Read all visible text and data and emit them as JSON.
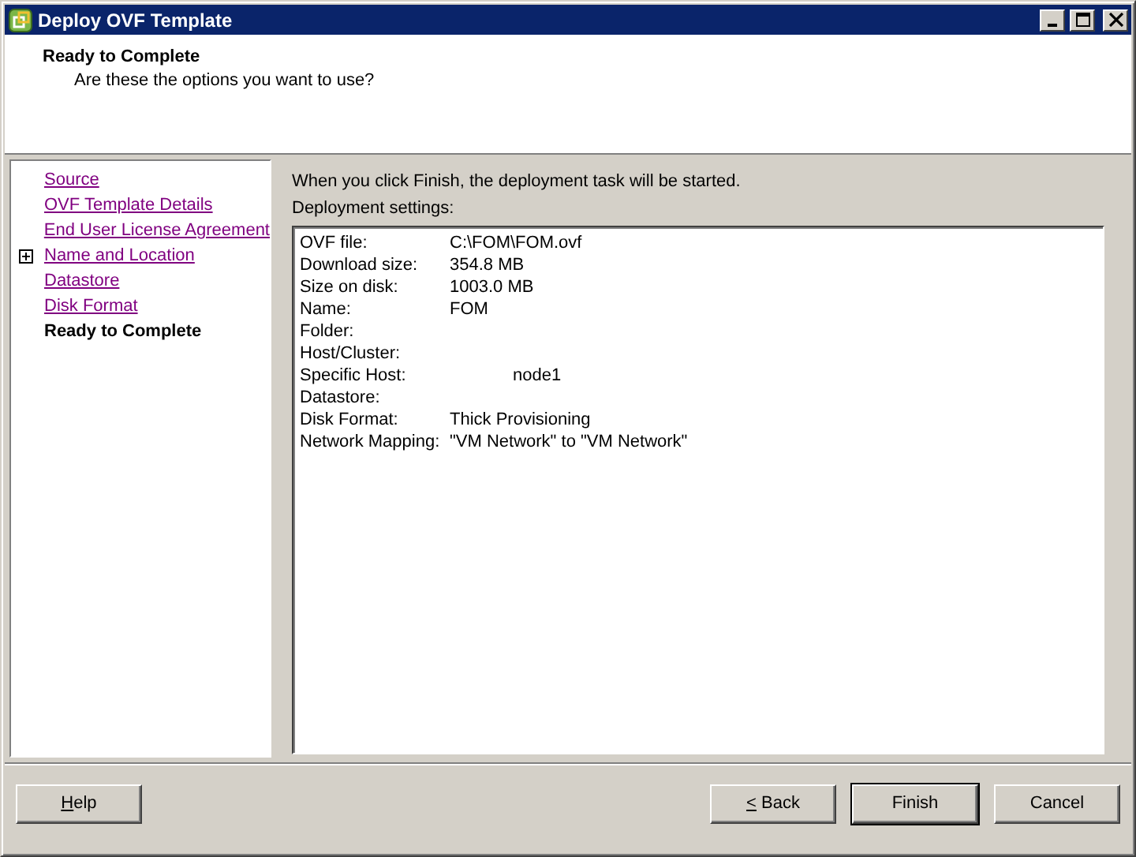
{
  "window": {
    "title": "Deploy OVF Template",
    "controls": [
      {
        "kind": "minimize"
      },
      {
        "kind": "maximize"
      },
      {
        "kind": "close"
      }
    ]
  },
  "header": {
    "title": "Ready to Complete",
    "subtitle": "Are these the options you want to use?"
  },
  "steps": [
    {
      "label": "Source",
      "selected": false,
      "expandable": false
    },
    {
      "label": "OVF Template Details",
      "selected": false,
      "expandable": false
    },
    {
      "label": "End User License Agreement",
      "selected": false,
      "expandable": false
    },
    {
      "label": "Name and Location",
      "selected": false,
      "expandable": true
    },
    {
      "label": "Datastore",
      "selected": false,
      "expandable": false
    },
    {
      "label": "Disk Format",
      "selected": false,
      "expandable": false
    },
    {
      "label": "Ready to Complete",
      "selected": true,
      "expandable": false
    }
  ],
  "intro": "When you click Finish, the deployment task will be started.",
  "settings_label": "Deployment settings:",
  "settings": [
    {
      "label": "OVF file:",
      "value": "C:\\FOM\\FOM.ovf",
      "kind": "plain"
    },
    {
      "label": "Download size:",
      "value": "354.8 MB",
      "kind": "plain"
    },
    {
      "label": "Size on disk:",
      "value": "1003.0 MB",
      "kind": "plain"
    },
    {
      "label": "Name:",
      "value": "FOM",
      "kind": "plain"
    },
    {
      "label": "Folder:",
      "kind": "plain"
    },
    {
      "label": "Host/Cluster:",
      "kind": "plain"
    },
    {
      "label": "Specific Host:",
      "value": "node1",
      "kind": "offset"
    },
    {
      "label": "Datastore:",
      "kind": "plain"
    },
    {
      "label": "Disk Format:",
      "value": "Thick Provisioning",
      "kind": "plain"
    },
    {
      "label": "Network Mapping:",
      "value": "\"VM Network\" to \"VM Network\"",
      "kind": "plain"
    }
  ],
  "buttons": [
    {
      "accel": "H",
      "label": "elp",
      "kind": "left",
      "default": false
    },
    {
      "accel": "<",
      "label": " Back",
      "kind": "right",
      "default": false
    },
    {
      "label": "Finish",
      "kind": "right",
      "default": true
    },
    {
      "label": "Cancel",
      "kind": "right",
      "default": false
    }
  ]
}
